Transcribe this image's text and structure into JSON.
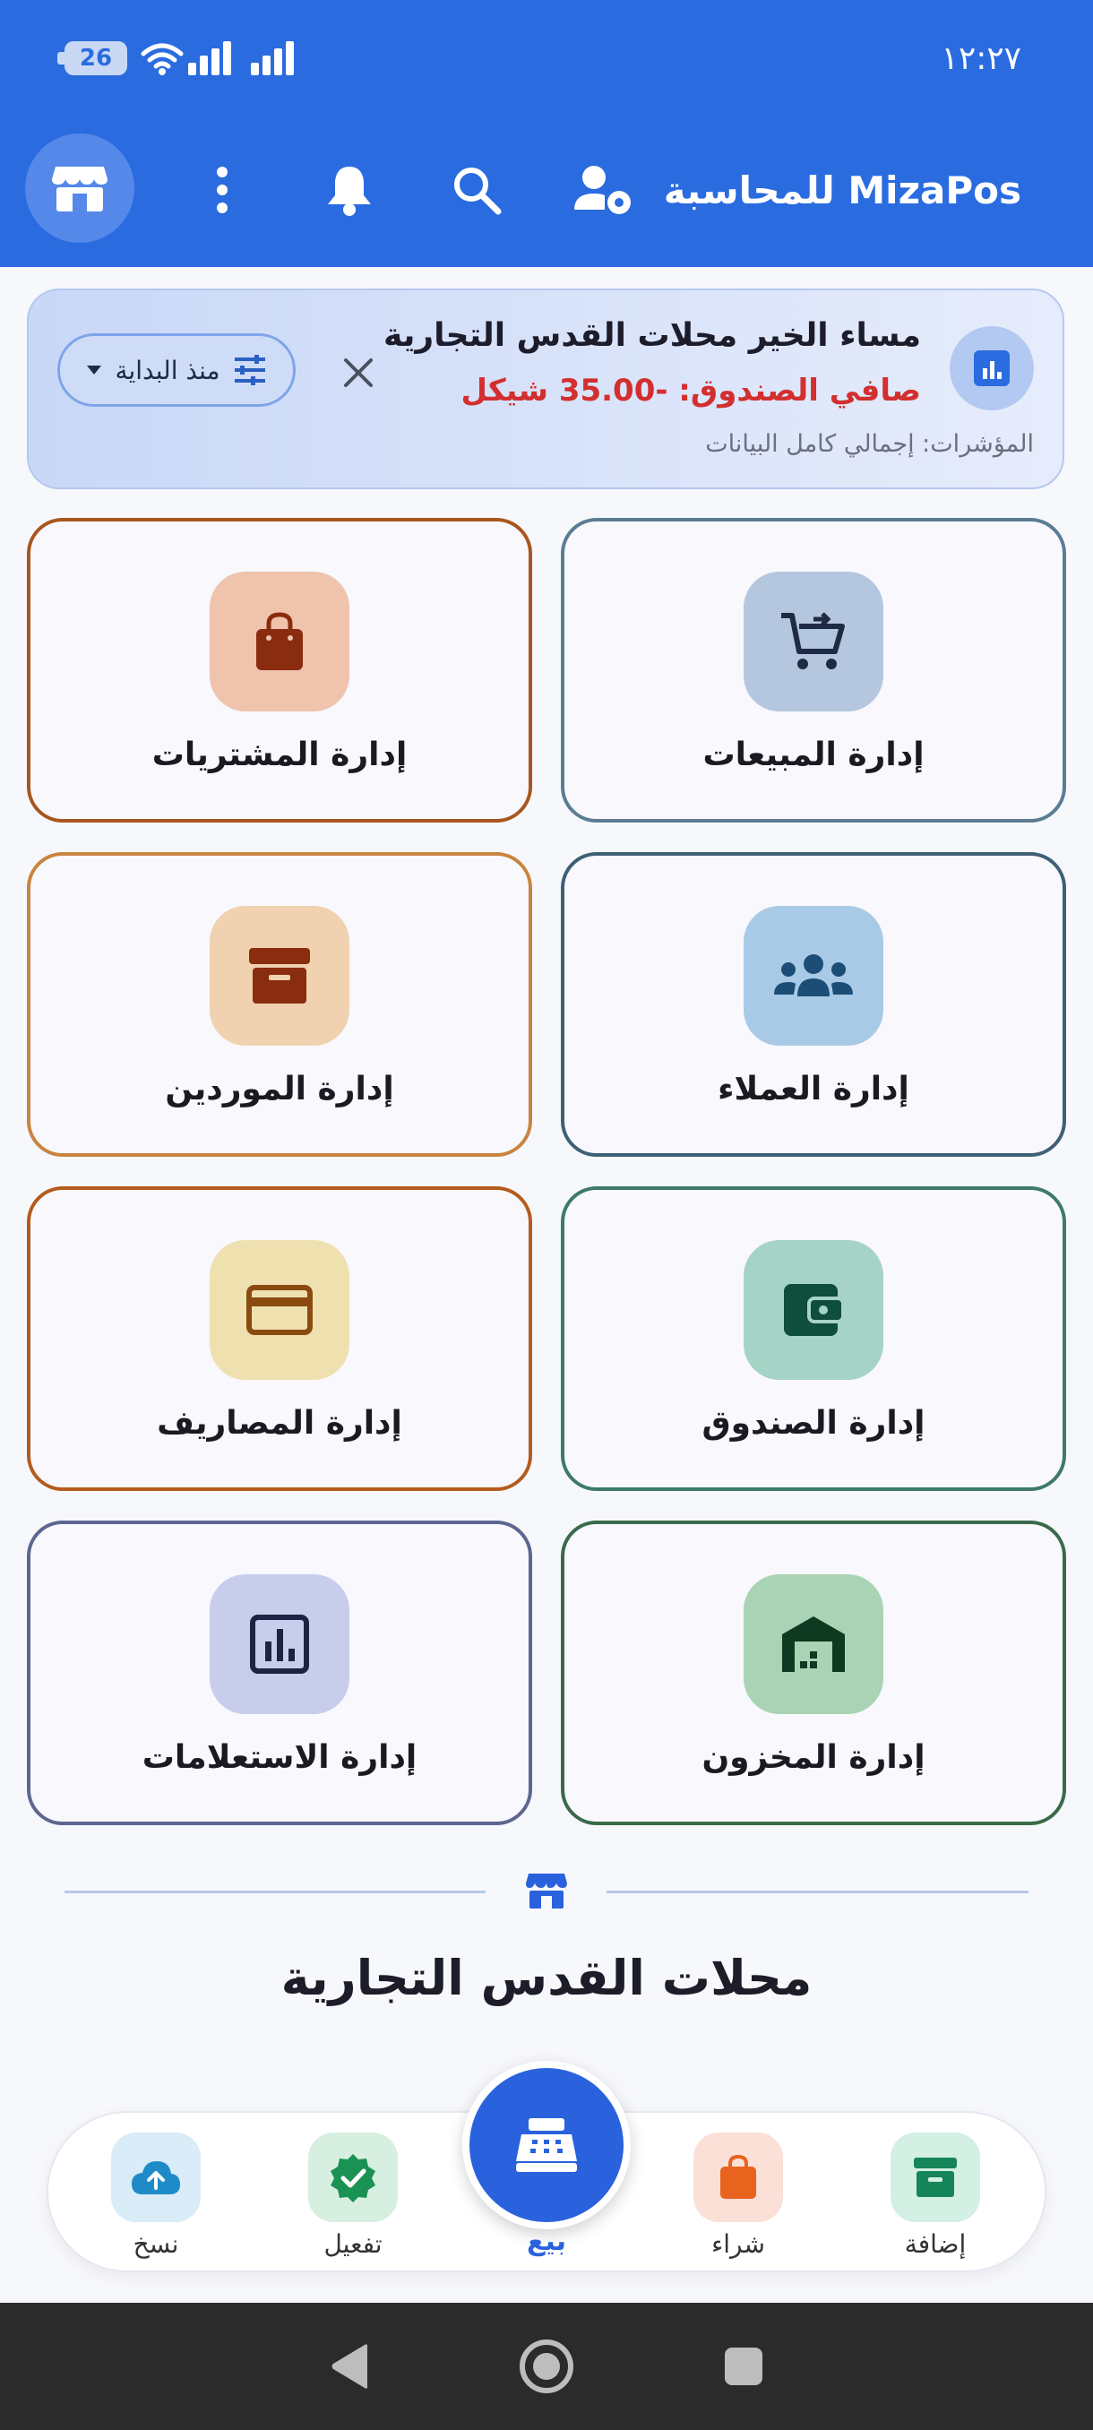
{
  "status_bar": {
    "battery": "26",
    "time": "١٢:٢٧"
  },
  "app_bar": {
    "title": "MizaPos للمحاسبة"
  },
  "greeting": {
    "title": "مساء الخير محلات القدس التجارية",
    "net_cash": "صافي الصندوق: -35.00 شيكل",
    "indicators": "المؤشرات: إجمالي كامل البيانات",
    "period_filter": "منذ البداية"
  },
  "tiles": [
    {
      "label": "إدارة المبيعات",
      "icon": "cart-icon",
      "border": "#5b7d94",
      "bg": "#b5c7df",
      "fg": "#1f2b44"
    },
    {
      "label": "إدارة المشتريات",
      "icon": "shopping-bag-icon",
      "border": "#a8561f",
      "bg": "#f0c3ad",
      "fg": "#8a2c10"
    },
    {
      "label": "إدارة العملاء",
      "icon": "people-icon",
      "border": "#3e6075",
      "bg": "#a9cae6",
      "fg": "#1c4d77"
    },
    {
      "label": "إدارة الموردين",
      "icon": "archive-box-icon",
      "border": "#c98440",
      "bg": "#f0d2b0",
      "fg": "#8a2c10"
    },
    {
      "label": "إدارة الصندوق",
      "icon": "wallet-icon",
      "border": "#3e7a68",
      "bg": "#a5d3c5",
      "fg": "#0f4d3c"
    },
    {
      "label": "إدارة المصاريف",
      "icon": "credit-card-icon",
      "border": "#b45b1e",
      "bg": "#efe0b0",
      "fg": "#8a4a10"
    },
    {
      "label": "إدارة المخزون",
      "icon": "warehouse-icon",
      "border": "#3a6a4a",
      "bg": "#a9d3b4",
      "fg": "#0f3a22"
    },
    {
      "label": "إدارة الاستعلامات",
      "icon": "bar-chart-icon",
      "border": "#5c6690",
      "bg": "#c8cdec",
      "fg": "#1c2344"
    }
  ],
  "store_name": "محلات القدس التجارية",
  "bottom_nav": {
    "add": "إضافة",
    "buy": "شراء",
    "sell": "بيع",
    "activate": "تفعيل",
    "backup": "نسخ"
  },
  "colors": {
    "primary": "#2a6be0",
    "danger": "#d32f2f"
  }
}
